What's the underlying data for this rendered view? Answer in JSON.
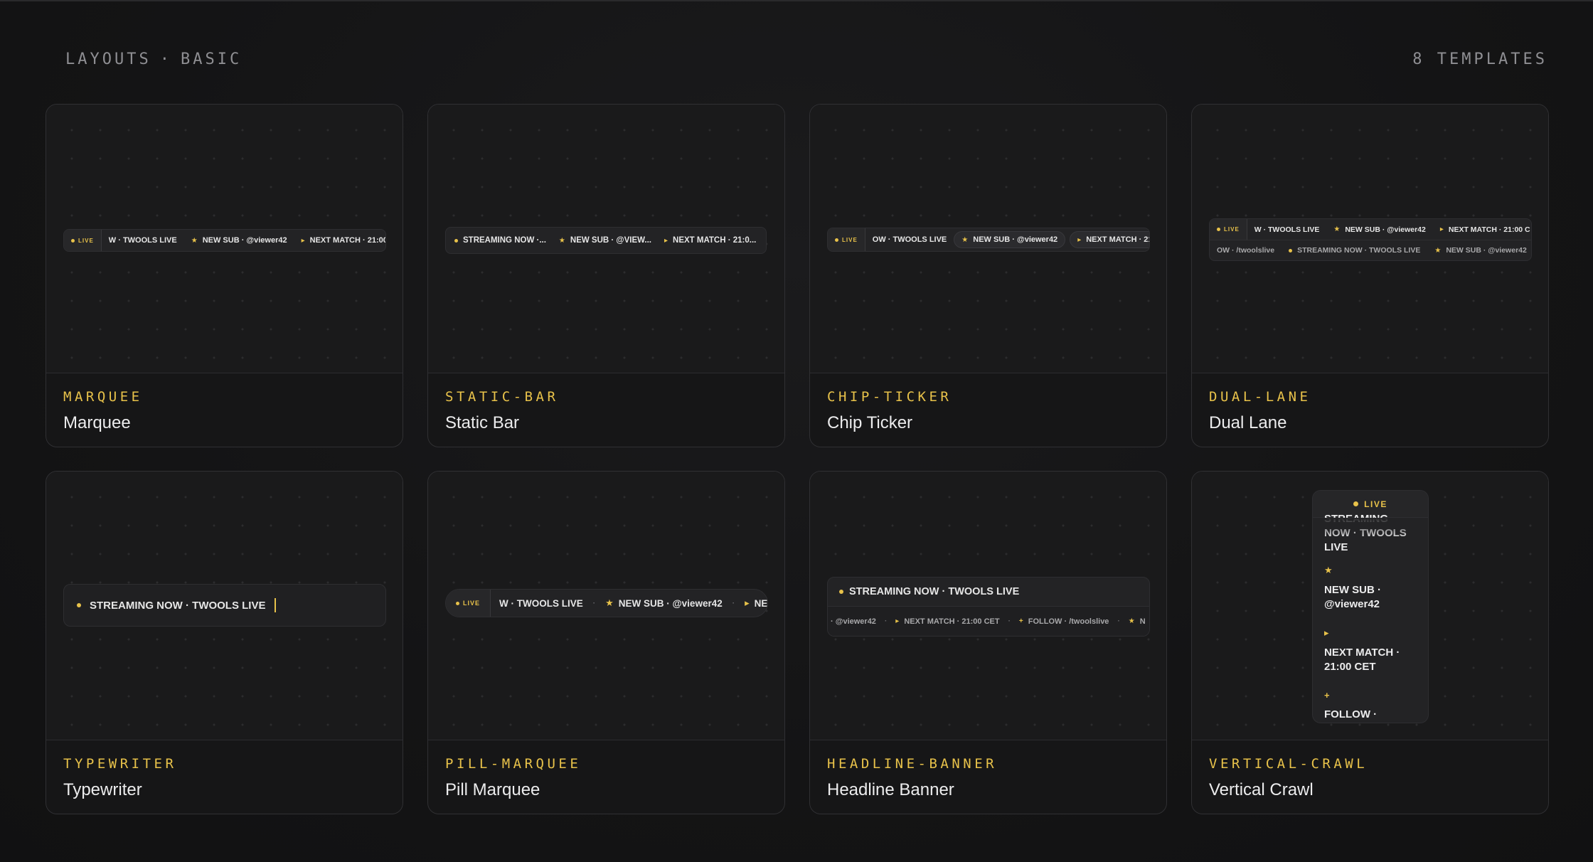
{
  "header": {
    "section": "LAYOUTS",
    "separator": "·",
    "subsection": "BASIC",
    "count": "8 TEMPLATES"
  },
  "colors": {
    "accent": "#e8c24a",
    "background": "#141415",
    "card": "#161617",
    "bar": "#232325"
  },
  "ticker": {
    "live": "LIVE",
    "streaming": "STREAMING NOW · TWOOLS LIVE",
    "streaming_partial": "W · TWOOLS LIVE",
    "streaming_partial_b": "OW · TWOOLS LIVE",
    "streaming_trunc": "STREAMING NOW ·...",
    "new_sub": "NEW SUB · @viewer42",
    "new_sub_trunc": "NEW SUB · @VIEW...",
    "next_match": "NEXT MATCH · 21:00 CET",
    "next_match_trunc": "NEXT MATCH · 21:0...",
    "next_match_cut": "NEXT MATCH · 21:0",
    "next_match_cut2": "NEXT MATCH · 21:00 C",
    "follow": "FOLLOW · /twoolslive",
    "follow_partial": "OW · /twoolslive",
    "viewer_partial": "· @viewer42",
    "ne_cut": "NE",
    "n_cut": "N"
  },
  "vertical": {
    "items": [
      {
        "icon": "dot-icon",
        "text": "STREAMING NOW · TWOOLS LIVE"
      },
      {
        "icon": "star-icon",
        "text": "NEW SUB · @viewer42"
      },
      {
        "icon": "arrow-icon",
        "text": "NEXT MATCH · 21:00 CET"
      },
      {
        "icon": "plus-icon",
        "text": "FOLLOW · /twoolslive"
      }
    ]
  },
  "cards": [
    {
      "slug": "MARQUEE",
      "name": "Marquee"
    },
    {
      "slug": "STATIC-BAR",
      "name": "Static Bar"
    },
    {
      "slug": "CHIP-TICKER",
      "name": "Chip Ticker"
    },
    {
      "slug": "DUAL-LANE",
      "name": "Dual Lane"
    },
    {
      "slug": "TYPEWRITER",
      "name": "Typewriter"
    },
    {
      "slug": "PILL-MARQUEE",
      "name": "Pill Marquee"
    },
    {
      "slug": "HEADLINE-BANNER",
      "name": "Headline Banner"
    },
    {
      "slug": "VERTICAL-CRAWL",
      "name": "Vertical Crawl"
    }
  ]
}
